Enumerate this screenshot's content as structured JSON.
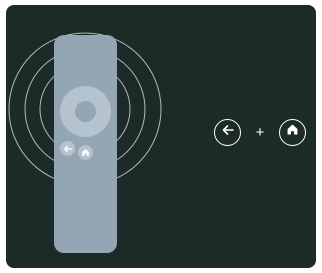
{
  "illustration": {
    "background_color": "#1c2a28",
    "remote_color": "#94a6b3",
    "ring_color": "#e6ecef",
    "remote_buttons": [
      {
        "icon": "back-arrow-icon"
      },
      {
        "icon": "home-icon"
      }
    ]
  },
  "shortcut": {
    "first_button_icon": "back-arrow-icon",
    "combiner": "+",
    "second_button_icon": "home-icon"
  }
}
